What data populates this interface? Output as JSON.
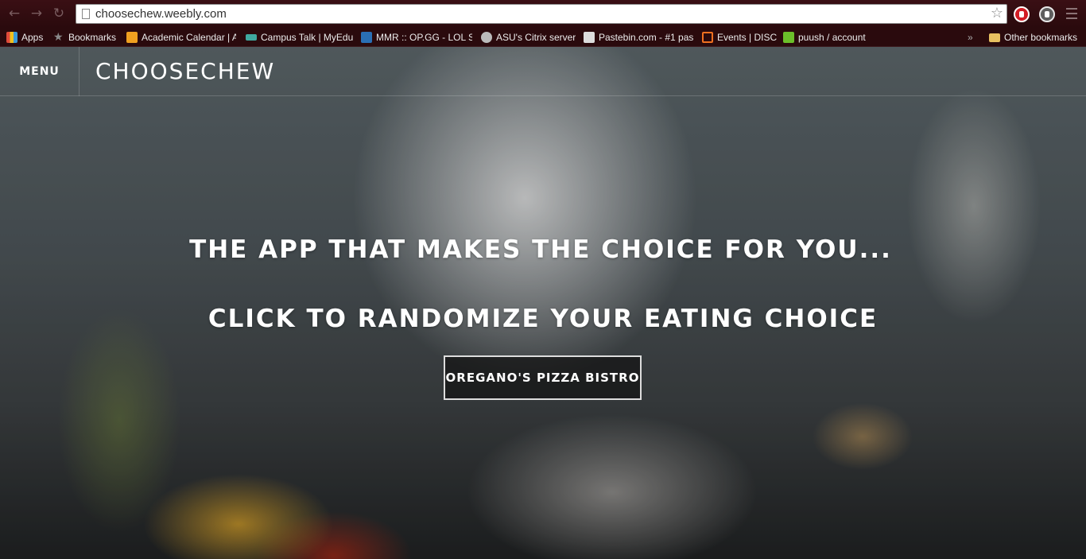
{
  "browser": {
    "url": "choosechew.weebly.com",
    "bookmarks": [
      {
        "label": "Apps",
        "icon": "apps-grid-icon",
        "color": "#e04a3a"
      },
      {
        "label": "Bookmarks",
        "icon": "star-icon",
        "color": "#8a8a8a"
      },
      {
        "label": "Academic Calendar | A",
        "icon": "calendar-icon",
        "color": "#f0a020"
      },
      {
        "label": "Campus Talk | MyEdu",
        "icon": "mortarboard-icon",
        "color": "#3fa9a0"
      },
      {
        "label": "MMR :: OP.GG - LOL S",
        "icon": "opgg-icon",
        "color": "#2a6fb5"
      },
      {
        "label": "ASU's Citrix server",
        "icon": "citrix-icon",
        "color": "#bbbbbb"
      },
      {
        "label": "Pastebin.com - #1 pas",
        "icon": "pastebin-icon",
        "color": "#dddddd"
      },
      {
        "label": "Events | DISC",
        "icon": "disc-icon",
        "color": "#f07020"
      },
      {
        "label": "puush / account",
        "icon": "puush-icon",
        "color": "#6bbf2a"
      },
      {
        "label": "Other bookmarks",
        "icon": "folder-icon",
        "color": "#e8c060"
      }
    ],
    "overflow_chevron": "»"
  },
  "site": {
    "menu_label": "MENU",
    "title": "CHOOSECHEW",
    "headline_1": "THE APP THAT MAKES THE CHOICE FOR YOU...",
    "headline_2": "CLICK TO RANDOMIZE YOUR EATING CHOICE",
    "cta_label": "OREGANO'S PIZZA BISTRO"
  }
}
